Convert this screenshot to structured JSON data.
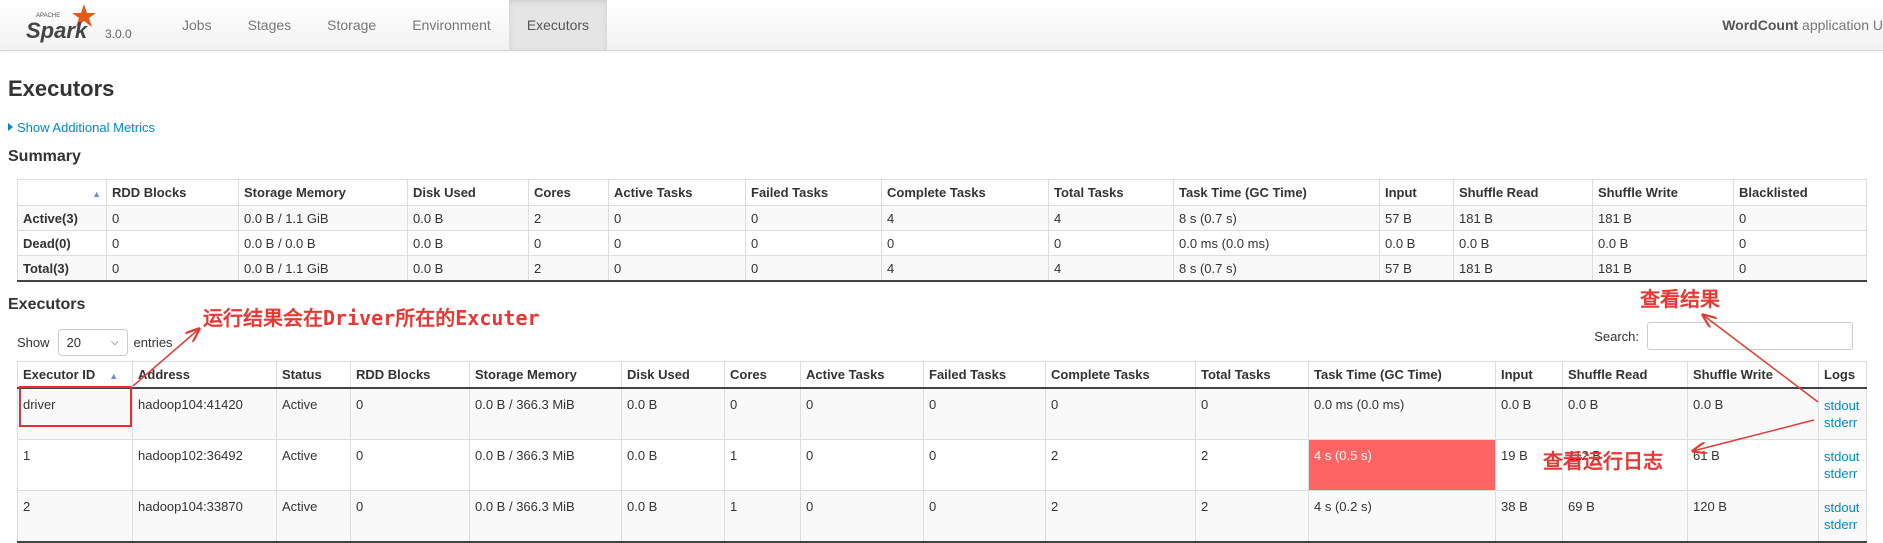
{
  "nav": {
    "brand_small": "APACHE",
    "brand": "Spark",
    "version": "3.0.0",
    "tabs": [
      "Jobs",
      "Stages",
      "Storage",
      "Environment",
      "Executors"
    ],
    "active_tab": "Executors",
    "app_name": "WordCount",
    "app_suffix": " application U"
  },
  "page": {
    "title": "Executors",
    "show_metrics": "Show Additional Metrics",
    "summary_title": "Summary",
    "executors_title": "Executors"
  },
  "summary": {
    "headers": [
      "",
      "RDD Blocks",
      "Storage Memory",
      "Disk Used",
      "Cores",
      "Active Tasks",
      "Failed Tasks",
      "Complete Tasks",
      "Total Tasks",
      "Task Time (GC Time)",
      "Input",
      "Shuffle Read",
      "Shuffle Write",
      "Blacklisted"
    ],
    "rows": [
      [
        "Active(3)",
        "0",
        "0.0 B / 1.1 GiB",
        "0.0 B",
        "2",
        "0",
        "0",
        "4",
        "4",
        "8 s (0.7 s)",
        "57 B",
        "181 B",
        "181 B",
        "0"
      ],
      [
        "Dead(0)",
        "0",
        "0.0 B / 0.0 B",
        "0.0 B",
        "0",
        "0",
        "0",
        "0",
        "0",
        "0.0 ms (0.0 ms)",
        "0.0 B",
        "0.0 B",
        "0.0 B",
        "0"
      ],
      [
        "Total(3)",
        "0",
        "0.0 B / 1.1 GiB",
        "0.0 B",
        "2",
        "0",
        "0",
        "4",
        "4",
        "8 s (0.7 s)",
        "57 B",
        "181 B",
        "181 B",
        "0"
      ]
    ]
  },
  "controls": {
    "show_label": "Show",
    "page_size": "20",
    "entries_label": "entries",
    "search_label": "Search:",
    "search_value": ""
  },
  "executors": {
    "headers": [
      "Executor ID",
      "Address",
      "Status",
      "RDD Blocks",
      "Storage Memory",
      "Disk Used",
      "Cores",
      "Active Tasks",
      "Failed Tasks",
      "Complete Tasks",
      "Total Tasks",
      "Task Time (GC Time)",
      "Input",
      "Shuffle Read",
      "Shuffle Write",
      "Logs"
    ],
    "rows": [
      [
        "driver",
        "hadoop104:41420",
        "Active",
        "0",
        "0.0 B / 366.3 MiB",
        "0.0 B",
        "0",
        "0",
        "0",
        "0",
        "0",
        "0.0 ms (0.0 ms)",
        "0.0 B",
        "0.0 B",
        "0.0 B"
      ],
      [
        "1",
        "hadoop102:36492",
        "Active",
        "0",
        "0.0 B / 366.3 MiB",
        "0.0 B",
        "1",
        "0",
        "0",
        "2",
        "2",
        "4 s (0.5 s)",
        "19 B",
        "112 B",
        "61 B"
      ],
      [
        "2",
        "hadoop104:33870",
        "Active",
        "0",
        "0.0 B / 366.3 MiB",
        "0.0 B",
        "1",
        "0",
        "0",
        "2",
        "2",
        "4 s (0.2 s)",
        "38 B",
        "69 B",
        "120 B"
      ]
    ],
    "log_links": [
      "stdout",
      "stderr"
    ],
    "highlight_color": "#ff6464"
  },
  "annotations": {
    "driver_note": "运行结果会在Driver所在的Excuter",
    "view_result": "查看结果",
    "view_log": "查看运行日志",
    "color": "#e53935"
  }
}
